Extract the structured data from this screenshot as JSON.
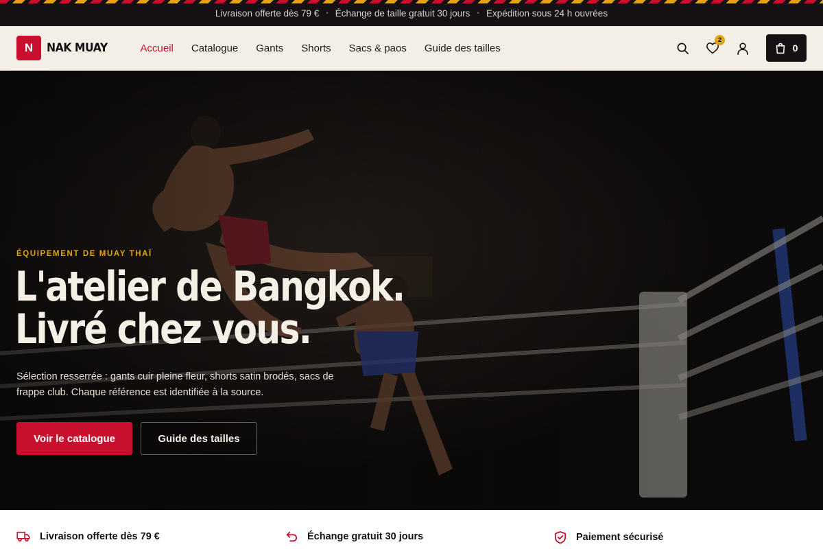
{
  "announcement": {
    "items": [
      "Livraison offerte dès 79 €",
      "Échange de taille gratuit 30 jours",
      "Expédition sous 24 h ouvrées"
    ],
    "separator": "•"
  },
  "header": {
    "logo_mark": "N",
    "logo_text": "NAK MUAY",
    "nav": [
      {
        "label": "Accueil",
        "active": true
      },
      {
        "label": "Catalogue",
        "active": false
      },
      {
        "label": "Gants",
        "active": false
      },
      {
        "label": "Shorts",
        "active": false
      },
      {
        "label": "Sacs & paos",
        "active": false
      },
      {
        "label": "Guide des tailles",
        "active": false
      }
    ],
    "wishlist_count": "2",
    "cart_count": "0",
    "icons": [
      "search-icon",
      "heart-icon",
      "user-icon",
      "bag-icon"
    ]
  },
  "hero": {
    "eyebrow": "ÉQUIPEMENT DE MUAY THAÏ",
    "title_line1": "L'atelier de Bangkok.",
    "title_line2": "Livré chez vous.",
    "description": "Sélection resserrée : gants cuir pleine fleur, shorts satin brodés, sacs de frappe club. Chaque référence est identifiée à la source.",
    "cta_primary": "Voir le catalogue",
    "cta_secondary": "Guide des tailles"
  },
  "benefits": [
    {
      "label": "Livraison offerte dès 79 €",
      "icon": "truck-icon"
    },
    {
      "label": "Échange gratuit 30 jours",
      "icon": "return-icon"
    },
    {
      "label": "Paiement sécurisé",
      "icon": "shield-check-icon"
    }
  ],
  "colors": {
    "accent": "#c8102e",
    "gold": "#e1a416",
    "dark": "#141014",
    "cream": "#f3efe7"
  }
}
